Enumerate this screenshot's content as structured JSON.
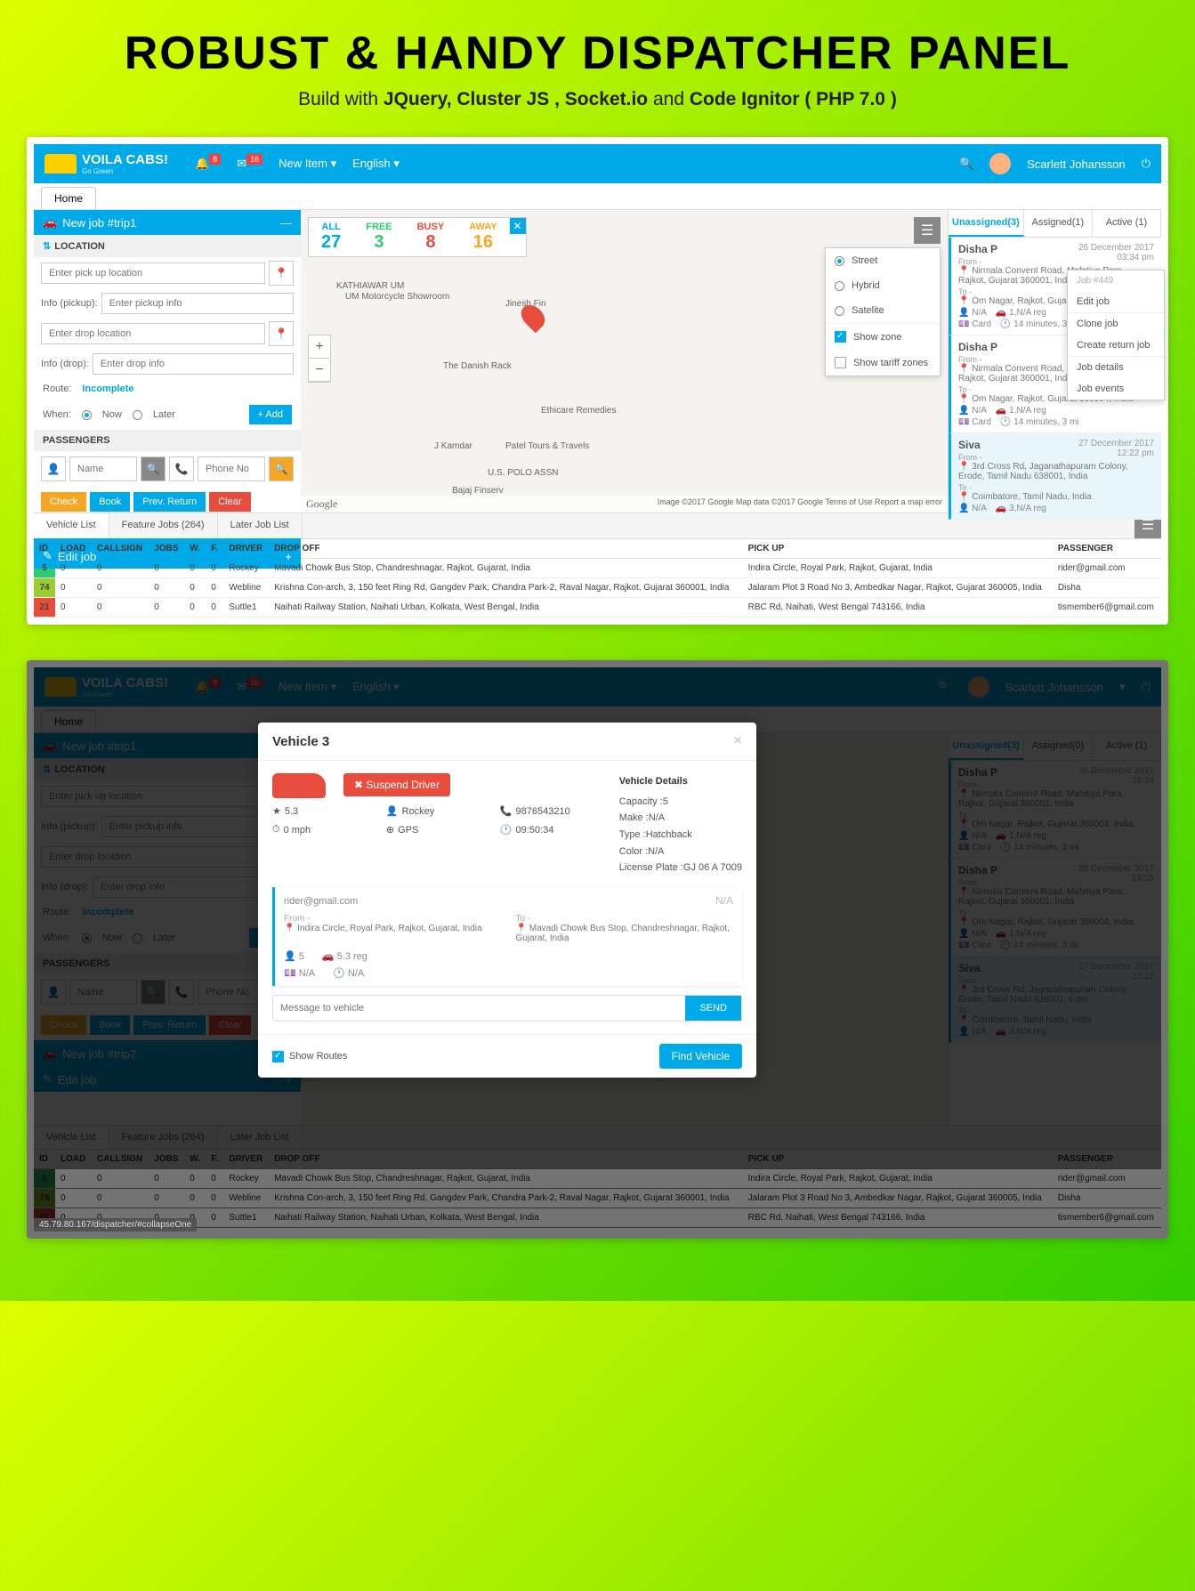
{
  "hero": {
    "title": "ROBUST & HANDY DISPATCHER PANEL",
    "sub_pre": "Build  with ",
    "sub_b1": "JQuery, Cluster JS , Socket.io",
    "sub_mid": " and ",
    "sub_b2": "Code Ignitor ( PHP 7.0 )"
  },
  "topbar": {
    "brand": "VOILA CABS!",
    "tagline": "Go Green",
    "notif_badge": "8",
    "mail_badge": "16",
    "new_item": "New Item ▾",
    "language": "English ▾",
    "user": "Scarlett Johansson"
  },
  "tab_home": "Home",
  "newjob": {
    "hd1": "New job #trip1",
    "loc_hd": "LOCATION",
    "pickup_ph": "Enter pick up location",
    "info_pickup_lbl": "Info (pickup):",
    "info_pickup_ph": "Enter pickup info",
    "drop_ph": "Enter drop location",
    "info_drop_lbl": "Info (drop):",
    "info_drop_ph": "Enter drop info",
    "route_lbl": "Route:",
    "incomplete": "Incomplete",
    "when_lbl": "When:",
    "now": "Now",
    "later": "Later",
    "add": "+ Add",
    "pass_hd": "PASSENGERS",
    "name_ph": "Name",
    "phone_ph": "Phone No",
    "check": "Check",
    "book": "Book",
    "prev": "Prev. Return",
    "clear": "Clear",
    "hd2": "New job #trip2",
    "edit": "Edit job"
  },
  "map": {
    "stats": {
      "all_l": "ALL",
      "all": "27",
      "free_l": "FREE",
      "free": "3",
      "busy_l": "BUSY",
      "busy": "8",
      "away_l": "AWAY",
      "away": "16"
    },
    "layers": {
      "street": "Street",
      "hybrid": "Hybrid",
      "satelite": "Satelite",
      "show_zone": "Show zone",
      "show_tariff": "Show tariff zones"
    },
    "pois": [
      "KATHIAWAR UM",
      "UM Motorcycle Showroom",
      "Jinesh Fin",
      "The Danish Rack",
      "Ethicare Remedies",
      "J Kamdar",
      "Patel Tours & Travels",
      "U.S. POLO ASSN",
      "Bajaj Finserv"
    ],
    "footer_google": "Google",
    "footer": "Image ©2017 Google   Map data ©2017 Google   Terms of Use   Report a map error"
  },
  "right": {
    "t1": "Unassigned(3)",
    "t2": "Assigned(1)",
    "t3": "Active (1)",
    "t2_b": "Assigned(0)",
    "jobs": [
      {
        "name": "Disha P",
        "date": "26 December 2017",
        "time": "03:34 pm",
        "from_l": "From -",
        "from": "Nirmala Convent Road, Mafatiya Para, Rajkot, Gujarat 360001, India",
        "to_l": "To -",
        "to": "Om Nagar, Rajkot, Gujarat 360004, India",
        "m1": "N/A",
        "m2": "1,N/A reg",
        "m3": "Card",
        "m4": "14 minutes, 3 mi"
      },
      {
        "name": "Disha P",
        "date": "26 December 2017",
        "time": "03:55 pm",
        "from_l": "From -",
        "from": "Nirmala Convent Road, Mafatiya Para, Rajkot, Gujarat 360001, India",
        "to_l": "To -",
        "to": "Om Nagar, Rajkot, Gujarat 360004, India",
        "m1": "N/A",
        "m2": "1,N/A reg",
        "m3": "Card",
        "m4": "14 minutes, 3 mi"
      },
      {
        "name": "Siva",
        "date": "27 December 2017",
        "time": "12:22 pm",
        "from_l": "From -",
        "from": "3rd Cross Rd, Jaganathapuram Colony, Erode, Tamil Nadu 638001, India",
        "to_l": "To -",
        "to": "Coimbatore, Tamil Nadu, India",
        "m1": "N/A",
        "m2": "3,N/A reg",
        "m3": "",
        "m4": ""
      }
    ],
    "jobs_b_times": [
      "15:34",
      "15:55",
      "12:22"
    ],
    "ctx": {
      "jobid": "Job #449",
      "edit": "Edit job",
      "clone": "Clone job",
      "ret": "Create return job",
      "details": "Job details",
      "events": "Job events"
    }
  },
  "bottom": {
    "t1": "Vehicle List",
    "t2": "Feature Jobs (264)",
    "t3": "Later Job List",
    "cols": [
      "ID",
      "LOAD",
      "CALLSIGN",
      "JOBS",
      "W.",
      "F.",
      "DRIVER",
      "DROP OFF",
      "PICK UP",
      "PASSENGER"
    ],
    "rows": [
      {
        "id": "5",
        "cls": "g",
        "load": "0",
        "cs": "0",
        "jobs": "0",
        "w": "0",
        "f": "0",
        "drv": "Rockey",
        "drop": "Mavadi Chowk Bus Stop, Chandreshnagar, Rajkot, Gujarat, India",
        "pick": "Indira Circle, Royal Park, Rajkot, Gujarat, India",
        "pass": "rider@gmail.com"
      },
      {
        "id": "74",
        "cls": "y",
        "load": "0",
        "cs": "0",
        "jobs": "0",
        "w": "0",
        "f": "0",
        "drv": "Webline",
        "drop": "Krishna Con-arch, 3, 150 feet Ring Rd, Gangdev Park, Chandra Park-2, Raval Nagar, Rajkot, Gujarat 360001, India",
        "pick": "Jalaram Plot 3 Road No 3, Ambedkar Nagar, Rajkot, Gujarat 360005, India",
        "pass": "Disha"
      },
      {
        "id": "21",
        "cls": "r",
        "load": "0",
        "cs": "0",
        "jobs": "0",
        "w": "0",
        "f": "0",
        "drv": "Suttle1",
        "drop": "Naihati Railway Station, Naihati Urban, Kolkata, West Bengal, India",
        "pick": "RBC Rd, Naihati, West Bengal 743166, India",
        "pass": "tismember6@gmail.com"
      }
    ]
  },
  "modal": {
    "title": "Vehicle 3",
    "suspend": "✖ Suspend Driver",
    "rating": "5.3",
    "driver": "Rockey",
    "phone": "9876543210",
    "speed": "0 mph",
    "gps": "GPS",
    "clock": "09:50:34",
    "vd_hd": "Vehicle Details",
    "cap": "Capacity :5",
    "make": "Make :N/A",
    "type": "Type :Hatchback",
    "color": "Color :N/A",
    "plate": "License Plate :GJ 06 A 7009",
    "email": "rider@gmail.com",
    "na": "N/A",
    "from_l": "From -",
    "from": "Indira Circle, Royal Park, Rajkot, Gujarat, India",
    "to_l": "To -",
    "to": "Mavadi Chowk Bus Stop, Chandreshnagar, Rajkot, Gujarat, India",
    "p": "5",
    "reg": "5.3 reg",
    "pay": "N/A",
    "dur": "N/A",
    "msg_ph": "Message to vehicle",
    "send": "SEND",
    "routes": "Show Routes",
    "find": "Find Vehicle"
  },
  "status_url": "45.79.80.167/dispatcher/#collapseOne"
}
